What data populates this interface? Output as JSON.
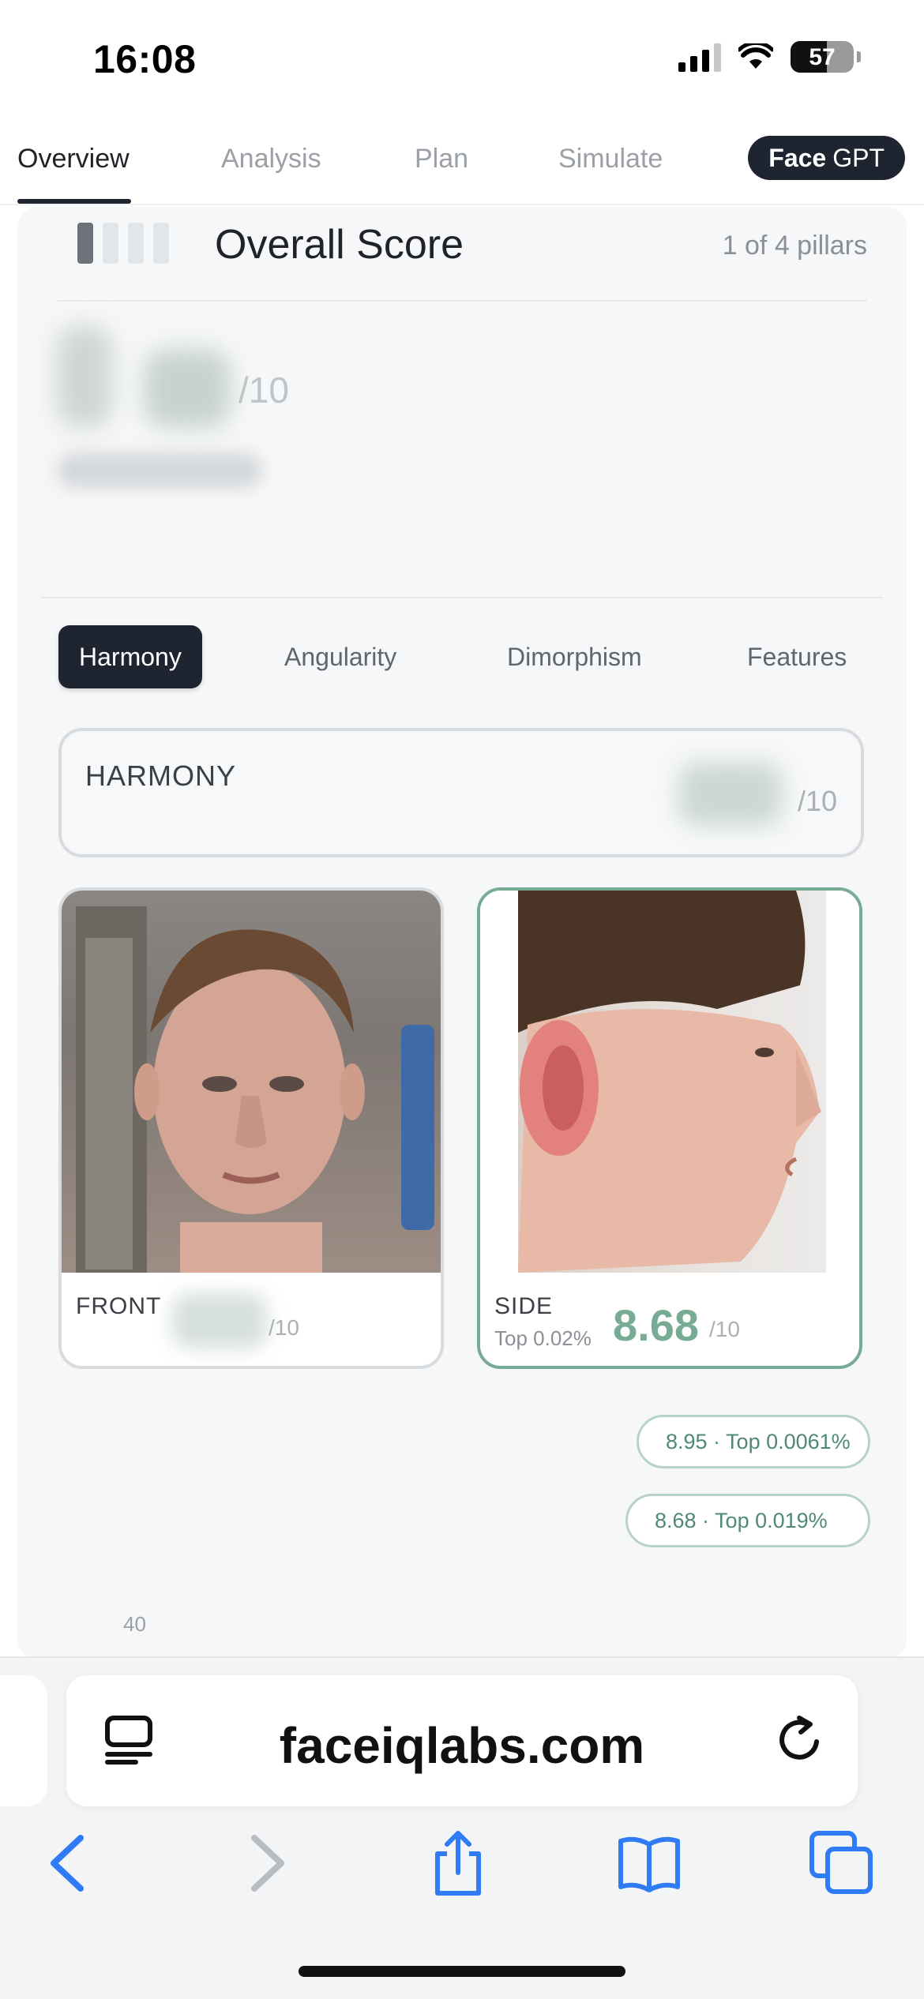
{
  "status_bar": {
    "time": "16:08",
    "battery": "57"
  },
  "tabs": {
    "items": [
      {
        "label": "Overview",
        "active": true
      },
      {
        "label": "Analysis",
        "active": false
      },
      {
        "label": "Plan",
        "active": false
      },
      {
        "label": "Simulate",
        "active": false
      }
    ],
    "facegpt_bold": "Face",
    "facegpt_rest": "GPT"
  },
  "overview": {
    "title": "Overall Score",
    "pillars_count": "1 of 4 pillars",
    "out_of": "/10"
  },
  "subtabs": [
    {
      "label": "Harmony",
      "active": true
    },
    {
      "label": "Angularity",
      "active": false
    },
    {
      "label": "Dimorphism",
      "active": false
    },
    {
      "label": "Features",
      "active": false
    }
  ],
  "harmony": {
    "label": "HARMONY",
    "out_of": "/10"
  },
  "photos": {
    "front": {
      "label": "FRONT",
      "out_of": "/10"
    },
    "side": {
      "label": "SIDE",
      "top": "Top 0.02%",
      "score": "8.68",
      "out_of": "/10"
    }
  },
  "chart_data": {
    "type": "area",
    "title": "",
    "y_tick": "40",
    "markers": [
      {
        "label": "8.95 · Top 0.0061%",
        "style": "dashed"
      },
      {
        "label": "8.68 · Top 0.019%",
        "style": "solid"
      }
    ]
  },
  "browser": {
    "url": "faceiqlabs.com"
  },
  "colors": {
    "accent": "#78ab94",
    "dark": "#1f2530",
    "ios_blue": "#2f7bf5"
  }
}
